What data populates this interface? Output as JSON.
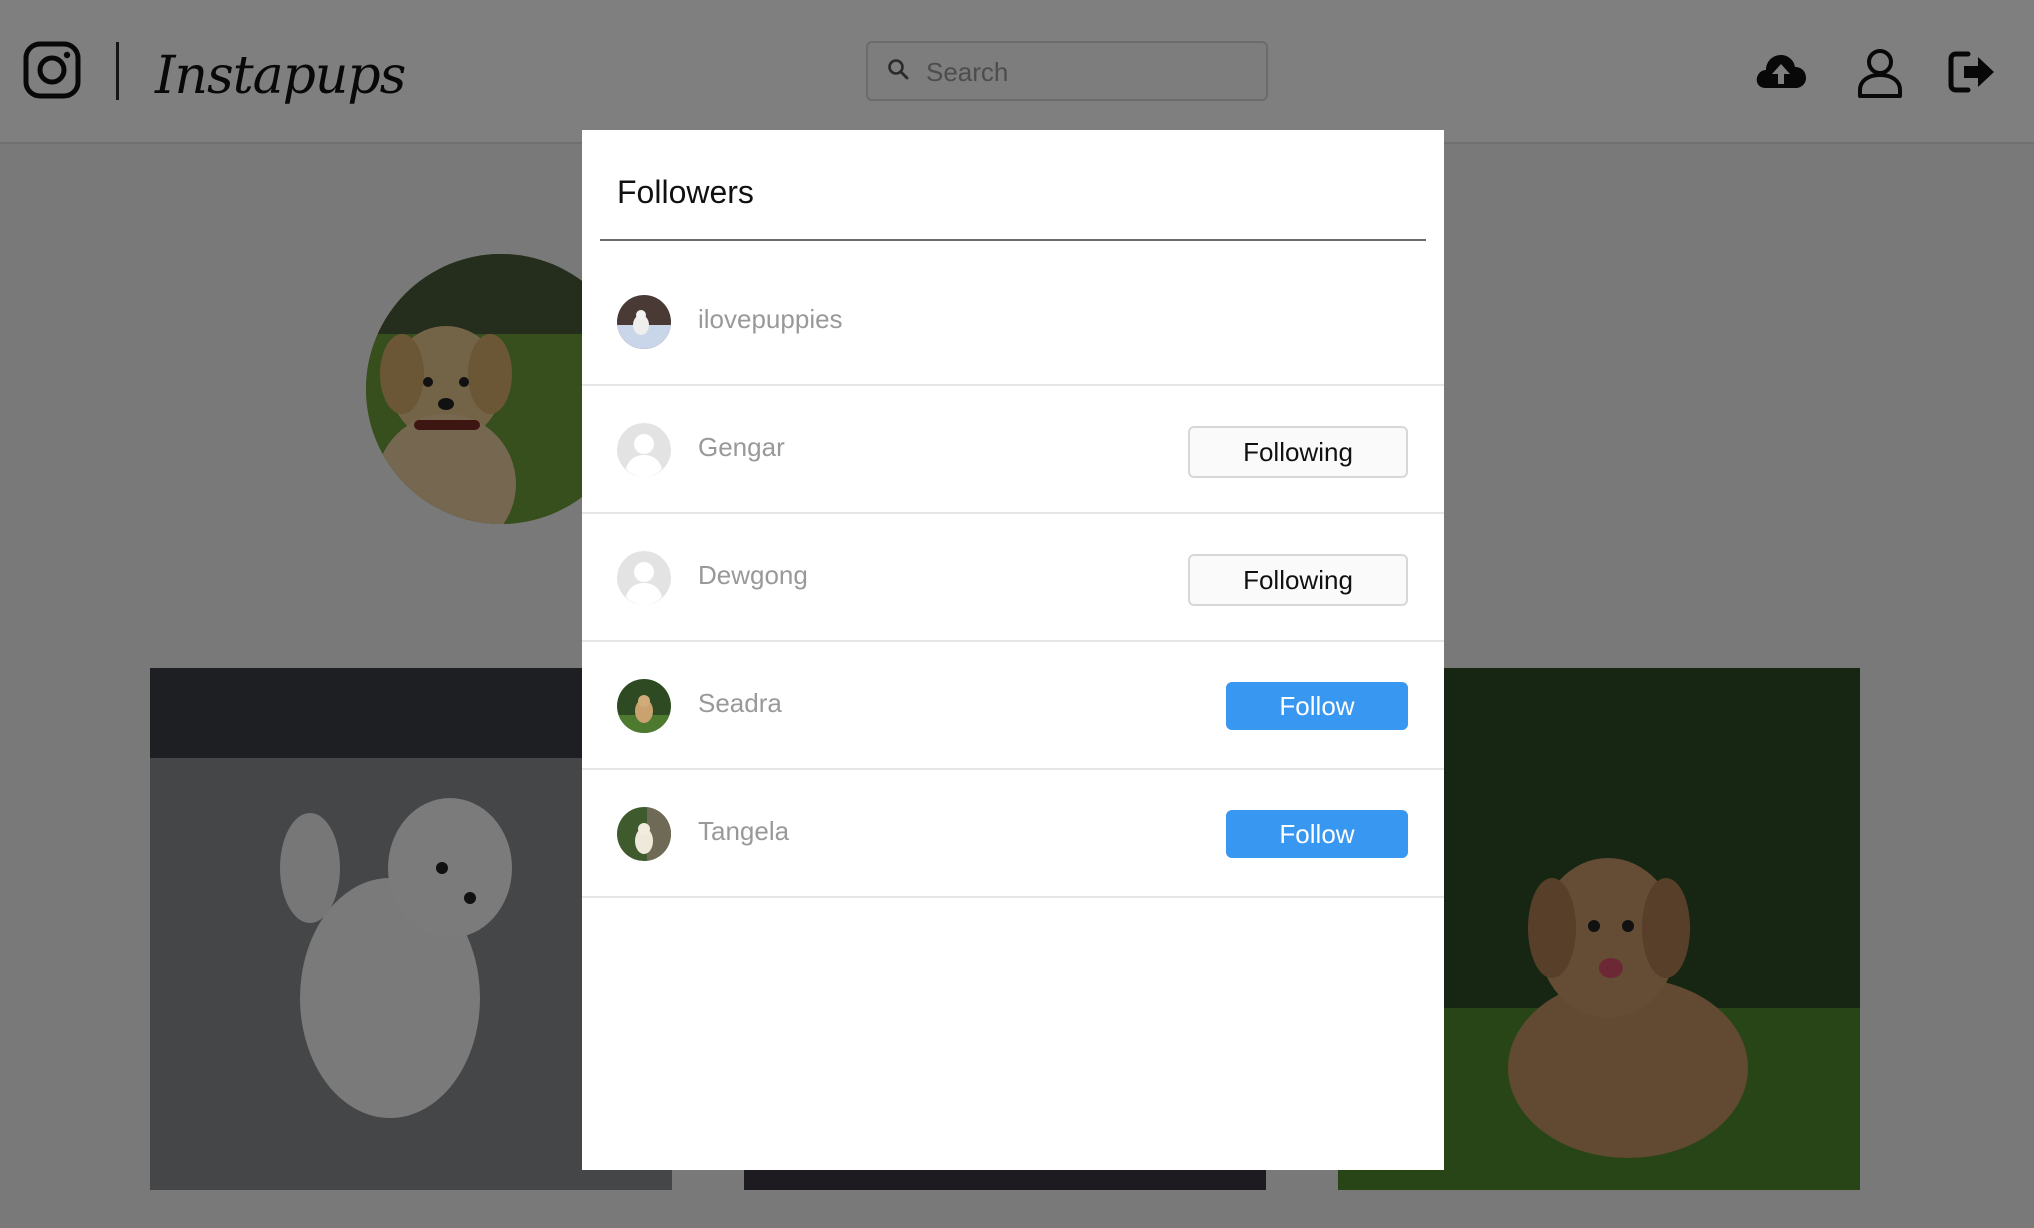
{
  "header": {
    "brand": "Instapups",
    "search": {
      "placeholder": "Search",
      "value": ""
    },
    "icons": {
      "logo": "instagram-icon",
      "upload": "cloud-upload-icon",
      "profile": "user-icon",
      "logout": "sign-out-icon"
    }
  },
  "modal": {
    "title": "Followers",
    "followers": [
      {
        "username": "ilovepuppies",
        "avatar": "photo",
        "button": ""
      },
      {
        "username": "Gengar",
        "avatar": "default-avatar",
        "button": "Following"
      },
      {
        "username": "Dewgong",
        "avatar": "default-avatar",
        "button": "Following"
      },
      {
        "username": "Seadra",
        "avatar": "photo",
        "button": "Follow"
      },
      {
        "username": "Tangela",
        "avatar": "photo",
        "button": "Follow"
      }
    ]
  },
  "colors": {
    "follow_button": "#3897f0",
    "overlay": "rgba(0,0,0,0.5)",
    "username_text": "#999999"
  }
}
